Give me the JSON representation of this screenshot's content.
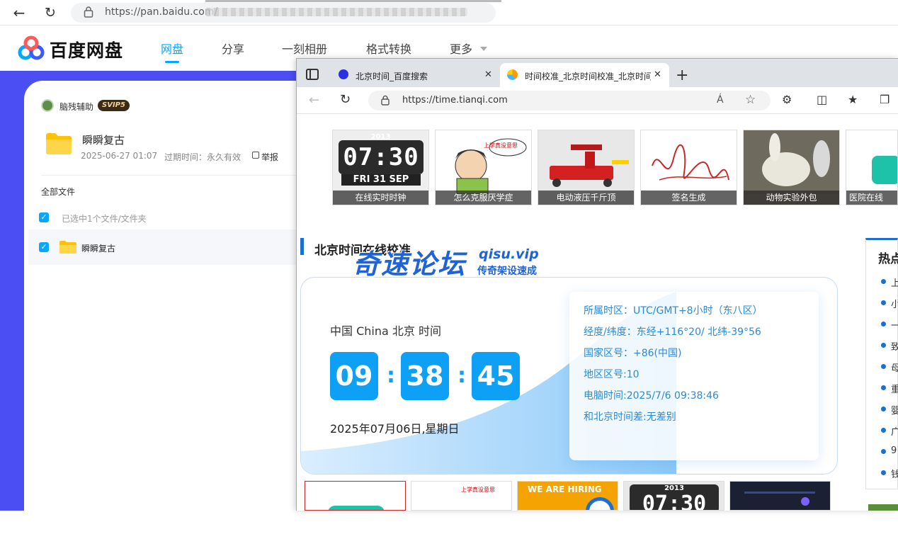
{
  "back_browser": {
    "url": "https://pan.baidu.com/"
  },
  "pan": {
    "brand": "百度网盘",
    "nav": [
      "网盘",
      "分享",
      "一刻相册",
      "格式转换",
      "更多"
    ],
    "user": {
      "name": "脑残辅助",
      "badge": "SVIP5"
    },
    "share": {
      "title": "瞬瞬复古",
      "date": "2025-06-27 01:07",
      "expire": "过期时间：永久有效",
      "report": "举报"
    },
    "all_files": "全部文件",
    "selected_text": "已选中1个文件/文件夹",
    "rows": [
      {
        "name": "瞬瞬复古"
      }
    ]
  },
  "edge": {
    "tabs": [
      {
        "title": "北京时间_百度搜索"
      },
      {
        "title": "时间校准_北京时间校准_北京时间"
      }
    ],
    "url": "https://time.tianqi.com",
    "read_aloud": "Á"
  },
  "page": {
    "thumbs": [
      {
        "caption": "在线实时时钟",
        "year": "2013",
        "time": "07:30",
        "date": "FRI 31 SEP"
      },
      {
        "caption": "怎么克服厌学症",
        "bubble": "上学真没意思"
      },
      {
        "caption": "电动液压千斤顶"
      },
      {
        "caption": "签名生成"
      },
      {
        "caption": "动物实验外包"
      },
      {
        "caption": "医院在线"
      }
    ],
    "section_title": "北京时间在线校准",
    "watermark": {
      "main": "奇速论坛",
      "site": "qisu.vip",
      "sub": "传奇架设速成"
    },
    "clock": {
      "location": "中国 China 北京 时间",
      "hh": "09",
      "mm": "38",
      "ss": "45",
      "date": "2025年07月06日,星期日"
    },
    "info": [
      "所属时区：UTC/GMT+8小时（东八区）",
      "经度/纬度：东经+116°20/ 北纬-39°56",
      "国家区号：+86(中国)",
      "地区区号:10",
      "电脑时间:2025/7/6 09:38:46",
      "和北京时间差:无差别"
    ],
    "hot": {
      "title": "热点",
      "items": [
        "上",
        "小",
        "一",
        "致",
        "母",
        "重",
        "婴",
        "广",
        "9",
        "钱"
      ]
    },
    "bottom_thumbs": [
      {
        "caption": ""
      },
      {
        "bubble": "上学真没意思"
      },
      {
        "caption": "WE ARE HIRING"
      },
      {
        "year": "2013",
        "time": "07:30"
      },
      {
        "caption": ""
      }
    ]
  },
  "colors": {
    "accent": "#06a7ff",
    "purple": "#4b4ef3",
    "clock_blue": "#0ea0f5",
    "info_blue": "#2a8ad6"
  }
}
